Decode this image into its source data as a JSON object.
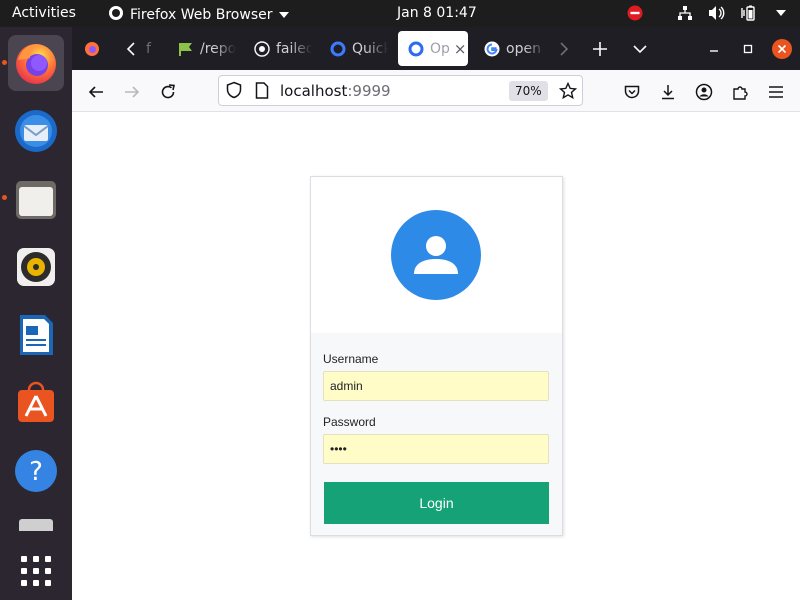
{
  "topbar": {
    "activities": "Activities",
    "app_name": "Firefox Web Browser",
    "clock": "Jan 8  01:47"
  },
  "dock": {
    "items": [
      "firefox-icon",
      "thunderbird-icon",
      "files-icon",
      "rhythmbox-icon",
      "writer-icon",
      "software-icon",
      "help-icon",
      "show-apps-icon"
    ]
  },
  "tabs": [
    {
      "label": "/repo",
      "icon": "flag-icon"
    },
    {
      "label": "failed",
      "icon": "github-icon"
    },
    {
      "label": "Quick",
      "icon": "quickwork-icon"
    },
    {
      "label": "Op",
      "icon": "quickwork-icon",
      "selected": true
    },
    {
      "label": "open",
      "icon": "google-icon"
    }
  ],
  "navbar": {
    "host": "localhost",
    "port": ":9999",
    "zoom": "70%"
  },
  "login": {
    "username_label": "Username",
    "username_value": "admin",
    "password_label": "Password",
    "password_value": "••••",
    "button_label": "Login"
  },
  "colors": {
    "avatar": "#2d8ae6",
    "login_button": "#14a276",
    "autofill": "#fffcc8",
    "accent_dot": "#e95420"
  }
}
